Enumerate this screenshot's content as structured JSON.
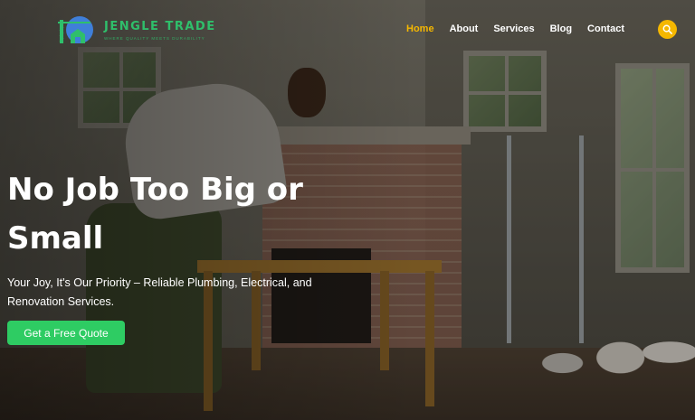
{
  "brand": {
    "name": "JENGLE TRADE",
    "tagline": "WHERE QUALITY MEETS DURABILITY",
    "logo_icon": "crane-house-logo",
    "accent_color": "#2fbf6b"
  },
  "nav": {
    "items": [
      {
        "label": "Home",
        "active": true
      },
      {
        "label": "About",
        "active": false
      },
      {
        "label": "Services",
        "active": false
      },
      {
        "label": "Blog",
        "active": false
      },
      {
        "label": "Contact",
        "active": false
      }
    ],
    "active_color": "#f5b700",
    "search_icon": "search-icon"
  },
  "hero": {
    "headline": "No Job Too Big or Small",
    "subtext": "Your Joy, It's Our Priority – Reliable Plumbing, Electrical, and Renovation Services.",
    "cta_label": "Get a Free Quote",
    "cta_color": "#2ecc63"
  }
}
